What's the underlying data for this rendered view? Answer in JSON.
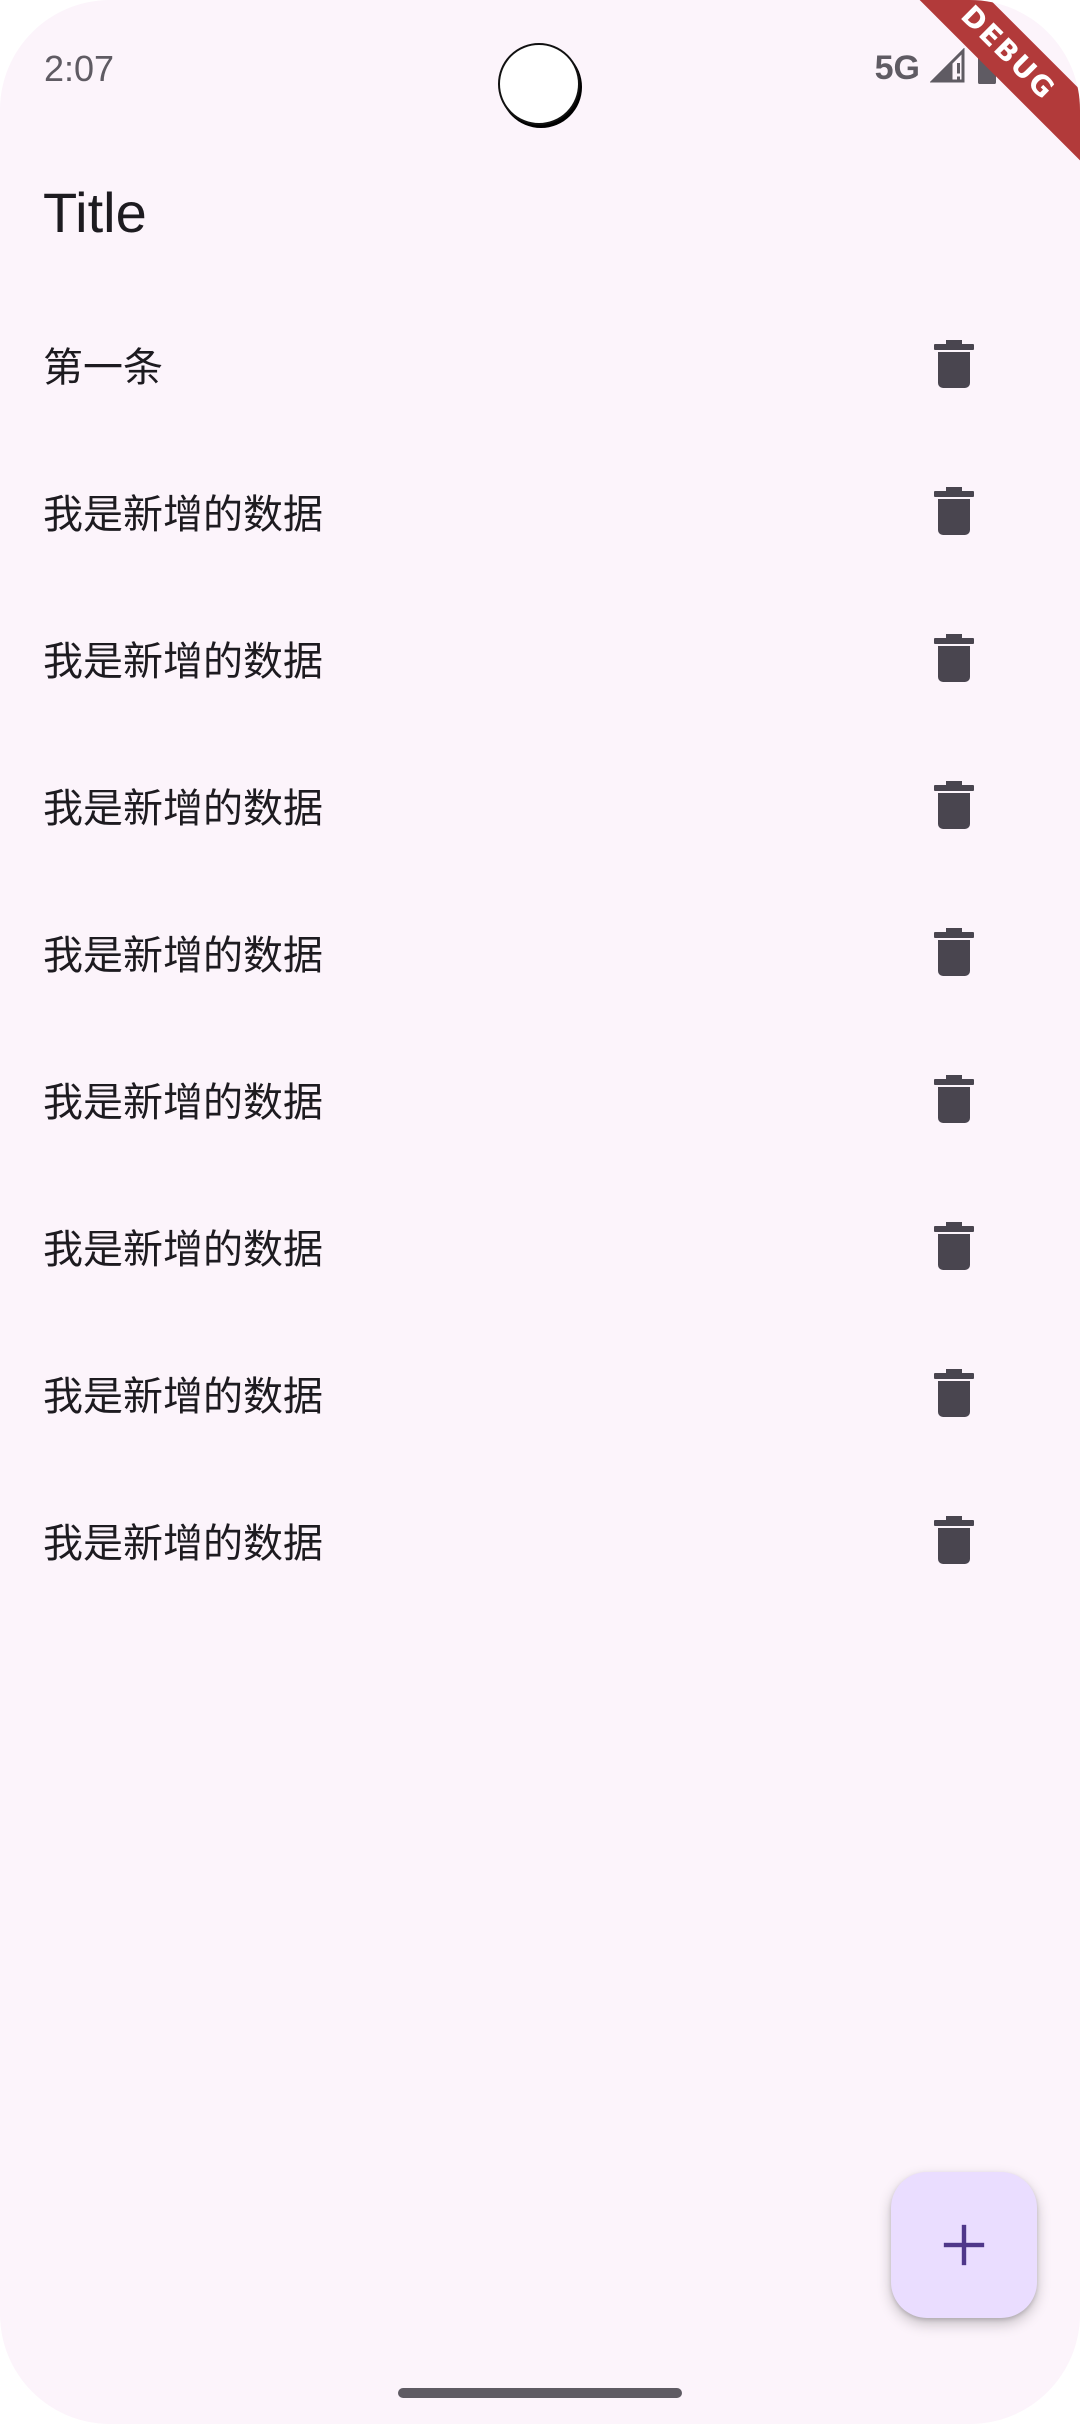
{
  "status_bar": {
    "time": "2:07",
    "network": "5G",
    "debug_banner": "DEBUG"
  },
  "app_bar": {
    "title": "Title"
  },
  "list": {
    "items": [
      {
        "label": "第一条"
      },
      {
        "label": "我是新增的数据"
      },
      {
        "label": "我是新增的数据"
      },
      {
        "label": "我是新增的数据"
      },
      {
        "label": "我是新增的数据"
      },
      {
        "label": "我是新增的数据"
      },
      {
        "label": "我是新增的数据"
      },
      {
        "label": "我是新增的数据"
      },
      {
        "label": "我是新增的数据"
      }
    ],
    "delete_icon": "trash-icon"
  },
  "fab": {
    "icon": "plus-icon"
  },
  "colors": {
    "background": "#fcf4fb",
    "text": "#1d1b20",
    "icon": "#49454f",
    "fab_background": "#eaddff",
    "fab_icon": "#4f378a",
    "debug_ribbon": "#b23a3a"
  }
}
